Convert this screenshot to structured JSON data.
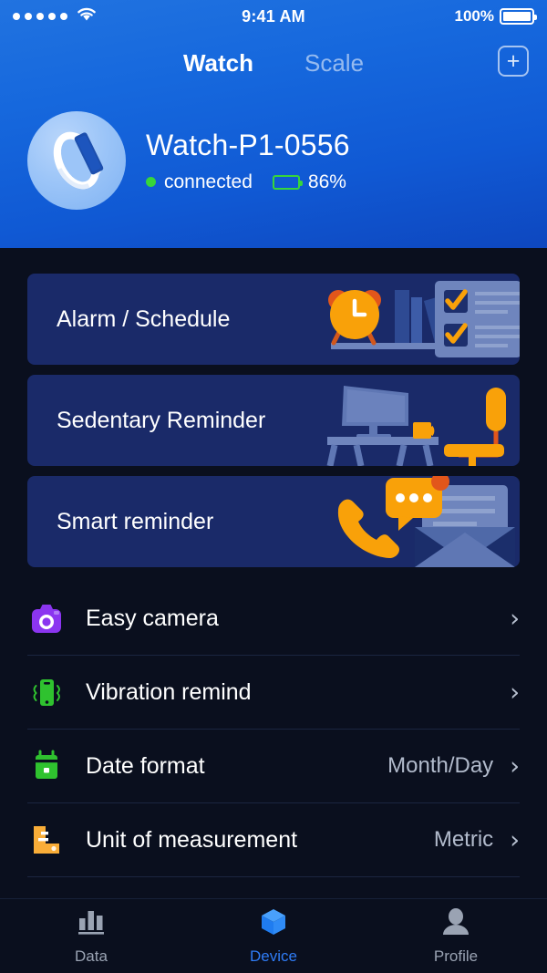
{
  "status_bar": {
    "signal_dots": 5,
    "wifi_icon": "wifi-icon",
    "time": "9:41 AM",
    "battery_percent": "100%"
  },
  "header": {
    "tabs": [
      {
        "label": "Watch",
        "active": true
      },
      {
        "label": "Scale",
        "active": false
      }
    ],
    "add_button_icon": "plus-square-icon",
    "accent_color": "#1668dd"
  },
  "device": {
    "avatar_icon": "watch-band-icon",
    "name": "Watch-P1-0556",
    "connection_status": "connected",
    "status_color": "#37d63b",
    "battery_percent": "86%",
    "battery_icon": "battery-icon"
  },
  "cards": [
    {
      "title": "Alarm / Schedule",
      "art": "alarm-clock-books-checklist-illustration"
    },
    {
      "title": "Sedentary Reminder",
      "art": "desk-monitor-chair-illustration"
    },
    {
      "title": "Smart reminder",
      "art": "phone-message-envelope-illustration"
    }
  ],
  "settings_rows": [
    {
      "label": "Easy camera",
      "value": "",
      "icon": "camera-icon",
      "icon_color": "#8b35f0"
    },
    {
      "label": "Vibration remind",
      "value": "",
      "icon": "vibration-phone-icon",
      "icon_color": "#2fc22f"
    },
    {
      "label": "Date format",
      "value": "Month/Day",
      "icon": "calendar-icon",
      "icon_color": "#2fc22f"
    },
    {
      "label": "Unit of measurement",
      "value": "Metric",
      "icon": "ruler-icon",
      "icon_color": "#f9ad38"
    }
  ],
  "chevron_glyph": "›",
  "tab_bar": {
    "items": [
      {
        "label": "Data",
        "icon": "bar-chart-icon",
        "active": false
      },
      {
        "label": "Device",
        "icon": "cube-icon",
        "active": true
      },
      {
        "label": "Profile",
        "icon": "person-icon",
        "active": false
      }
    ],
    "active_color": "#2f7cf6"
  }
}
